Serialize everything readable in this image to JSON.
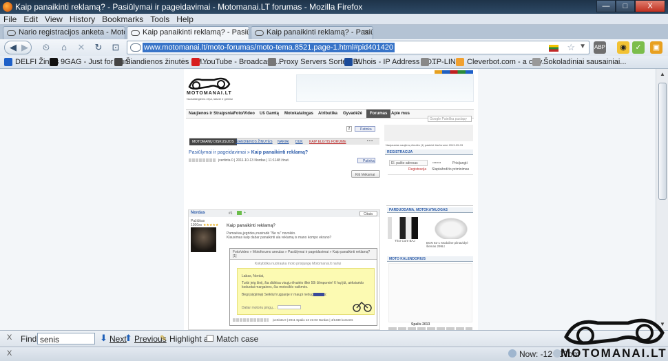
{
  "window": {
    "title": "Kaip panaikinti reklamą? - Pasiūlymai ir pageidavimai - Motomanai.LT forumas - Mozilla Firefox",
    "minimize_label": "—",
    "maximize_label": "□",
    "close_label": "X"
  },
  "menu": [
    "File",
    "Edit",
    "View",
    "History",
    "Bookmarks",
    "Tools",
    "Help"
  ],
  "tabs": [
    {
      "label": "Nario registracijos anketa - Motoman..."
    },
    {
      "label": "Kaip panaikinti reklamą? - Pasiūlymai ..."
    },
    {
      "label": "Kaip panaikinti reklamą? - Pasiūlymai ..."
    }
  ],
  "new_tab_label": "+",
  "url": "www.motomanai.lt/moto-forumas/moto-tema.8521.page-1.html#pid401420",
  "bookmarks": [
    {
      "label": "DELFI Žinios",
      "color": "#1e60c8"
    },
    {
      "label": "9GAG - Just for Fun!",
      "color": "#111111"
    },
    {
      "label": "Šiandienos žinutės - M...",
      "color": "#444444"
    },
    {
      "label": "YouTube - Broadcast ...",
      "color": "#d81e1e"
    },
    {
      "label": "Proxy Servers Sorted B...",
      "color": "#777777"
    },
    {
      "label": "Whois - IP Address - D...",
      "color": "#1a4a99"
    },
    {
      "label": "TP-LINK",
      "color": "#888888"
    },
    {
      "label": "Cleverbot.com - a clev...",
      "color": "#f0a030"
    },
    {
      "label": "Šokoladiniai sausainiai...",
      "color": "#999999"
    }
  ],
  "site": {
    "logo_text": "MOTOMANAI.LT",
    "logo_sub": "Nuotaikingiems vėjui, laisvei ir greičiui",
    "nav": [
      "Naujienos ir Straipsniai",
      "Foto/Video",
      "Uš Gamtą",
      "Motokatalogas",
      "Atributika",
      "Gyvadėžė",
      "Forumas",
      "Apie mus"
    ],
    "active_nav": "Forumas",
    "search_placeholder": "Google Paieška puslapy",
    "fb_label": "Patinka",
    "forum_tabs": [
      "MOTOMANŲ DISKUSIJOS",
      "ŠIANDIENOS ŽINUTĖS",
      "NARIAI",
      "DUK",
      "KAIP ELGTIS FORUME"
    ],
    "more": "• • •",
    "breadcrumb_parent": "Pasiūlymai ir pageidavimai",
    "breadcrumb_sep": "»",
    "breadcrumb_current": "Kaip panaikinti reklamą?",
    "thread_meta": "įvertinta 0 | 2011-10-13 Nordas | 11:1148 žinut.",
    "thread_fb": "Patinka",
    "other_views": "Kiti Veiksmai",
    "reg_line": "Naujausias naujienų žinutės (1) pasiekė šia forume 2013-09-03",
    "reg_header": "REGISTRACIJA",
    "reg_email_label": "El. pašto adresas",
    "reg_pass_mask": "•••••••",
    "reg_remember": "Prisijungti",
    "reg_register": "Registracija",
    "reg_forgot": "Slaptažodžio priminimas",
    "post_author": "Nordas",
    "post_rank": "Pažiūkas",
    "post_count": "1300xx",
    "post_num": "#1",
    "post_quote_btn": "Citata",
    "post_title": "Kaip panaikinti reklamą?",
    "post_line1": "Pamaėiau,jegrideu,nusiradė \"Ne ru\" novoikio.",
    "post_line2": "Klausimas kaip dabar panaikinti ala reklamą is mano kompo ekrano?",
    "quote_path": "Foto/video » Motoforumo aneulas » Pasiūlymai ir pageidavimai » Kaip panaikinti reklamą? [1]",
    "ad_title": "Kokybiška nuotrauka moto prisijungę Motomanai.lt narlui",
    "ad_hello": "Labas, Nordai,",
    "ad_body": "Turbi jeig šiniį, šia didriisa visųju ėlvaiėio ilikė 50i čilmpomie! 6 hąi jūt, aėksiuėdo koduotai margaiees, čia motociklo vaikmės.",
    "ad_more": "Bėgi įsijojimęji Seikliuf rugpanje ir maupi nešuga speiks:",
    "ad_footer": "Daliar motoriu pingų...",
    "post_footer": "įvertinta 0 | 2011 Spalio 13 21:03 Nordas | 4/1339 komentt.",
    "side_header1": "PARDUODAMA, MOTOKATALOGAS",
    "product1": "Thor Core BAJ",
    "product2": "BGN 82-1 Moduline pilnavidyė šlemas 299Lt",
    "side_header2": "MOTO KALENDORIUS",
    "cal_month": "Spalis 2013"
  },
  "findbar": {
    "close": "X",
    "label": "Find:",
    "value": "senis",
    "next": "Next",
    "previous": "Previous",
    "highlight": "Highlight all",
    "match_case": "Match case"
  },
  "statusbar": {
    "close": "X",
    "weather": "Now: -12 °C",
    "tomorrow": "Tom"
  },
  "watermark": "MOTOMANAI.LT"
}
